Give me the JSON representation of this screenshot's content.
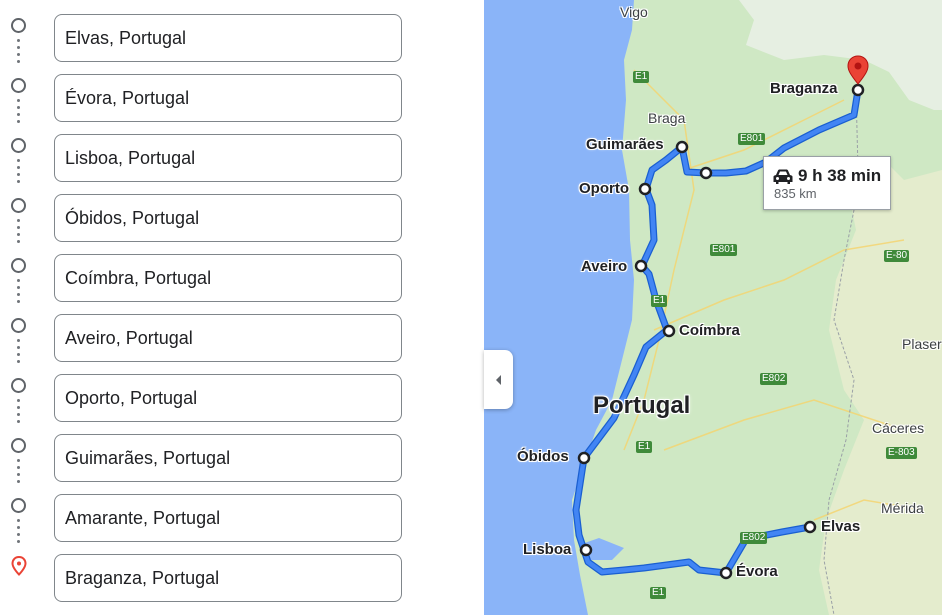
{
  "stops": [
    {
      "label": "Elvas, Portugal",
      "icon": "circle"
    },
    {
      "label": "Évora, Portugal",
      "icon": "circle"
    },
    {
      "label": "Lisboa, Portugal",
      "icon": "circle"
    },
    {
      "label": "Óbidos, Portugal",
      "icon": "circle"
    },
    {
      "label": "Coímbra, Portugal",
      "icon": "circle"
    },
    {
      "label": "Aveiro, Portugal",
      "icon": "circle"
    },
    {
      "label": "Oporto, Portugal",
      "icon": "circle"
    },
    {
      "label": "Guimarães, Portugal",
      "icon": "circle"
    },
    {
      "label": "Amarante, Portugal",
      "icon": "circle"
    },
    {
      "label": "Braganza, Portugal",
      "icon": "destination-pin"
    }
  ],
  "map": {
    "country_label": "Portugal",
    "route_summary": {
      "duration": "9 h 38 min",
      "distance": "835 km",
      "icon": "car-icon"
    },
    "city_labels": {
      "braganza": "Braganza",
      "guimaraes": "Guimarães",
      "oporto": "Oporto",
      "aveiro": "Aveiro",
      "coimbra": "Coímbra",
      "obidos": "Óbidos",
      "lisboa": "Lisboa",
      "evora": "Évora",
      "elvas": "Elvas"
    },
    "place_labels": {
      "vigo": "Vigo",
      "braga": "Braga",
      "caceres": "Cáceres",
      "merida": "Mérida",
      "plasencia": "Plaser"
    },
    "road_labels": {
      "e801_north": "E801",
      "e801_mid": "E801",
      "e1_north": "E1",
      "e1_mid": "E1",
      "e1_south": "E1",
      "e1_bottom": "E1",
      "e80": "E-80",
      "e802_mid": "E802",
      "e802_south": "E802",
      "e803": "E-803"
    },
    "colors": {
      "route": "#4285f4",
      "route_border": "#1a5fd0",
      "sea": "#8ab4f8",
      "land": "#cfe8c4",
      "pin": "#ea4335"
    }
  }
}
